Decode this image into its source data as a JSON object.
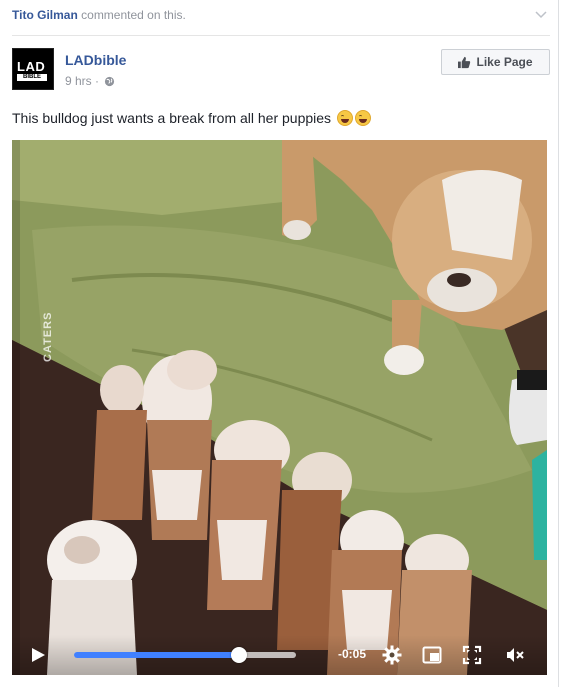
{
  "story": {
    "actor": "Tito Gilman",
    "action": "commented on this."
  },
  "post": {
    "page_name": "LADbible",
    "avatar_text_top": "LAD",
    "avatar_text_bottom": "BIBLE",
    "time": "9 hrs",
    "separator": "·",
    "like_button": "Like Page",
    "text": "This bulldog just wants a break from all her puppies"
  },
  "video": {
    "watermark": "CATERS",
    "time_remaining": "-0:05",
    "progress_fraction": 0.745
  },
  "colors": {
    "link": "#365899",
    "progress": "#4080ff",
    "muted": "#90949c"
  }
}
